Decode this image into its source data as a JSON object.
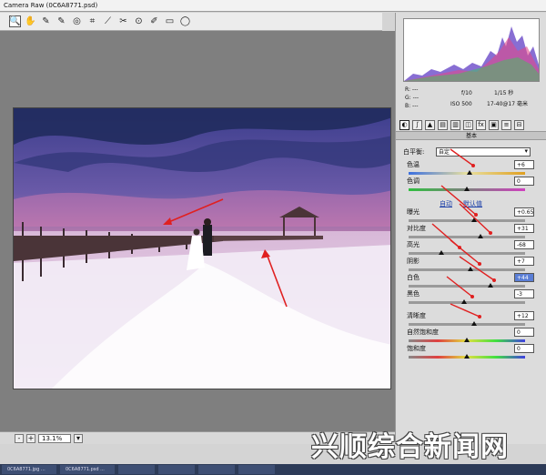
{
  "window": {
    "title": "Camera Raw (0C6A8771.psd)"
  },
  "toolbar": {
    "tools": [
      "zoom-icon",
      "hand-icon",
      "eyedropper-icon",
      "color-sampler-icon",
      "target-adjust-icon",
      "crop-icon",
      "straighten-icon",
      "spot-removal-icon",
      "red-eye-icon",
      "brush-icon",
      "gradient-icon"
    ]
  },
  "zoom": {
    "value": "13.1%",
    "minus": "-",
    "plus": "+"
  },
  "readouts": {
    "r": "R: ---",
    "g": "G: ---",
    "b": "B: ---",
    "aperture": "f/10",
    "shutter": "1/15 秒",
    "iso": "ISO 500",
    "lens": "17-40@17 毫米"
  },
  "panel": {
    "section_title": "基本",
    "white_balance_label": "白平衡:",
    "white_balance_value": "自定",
    "auto_label": "自动",
    "default_label": "默认值",
    "sliders": [
      {
        "label": "色温",
        "value": "+6",
        "pos": 0.52
      },
      {
        "label": "色调",
        "value": "0",
        "pos": 0.5
      },
      {
        "label": "曝光",
        "value": "+0.65",
        "pos": 0.56
      },
      {
        "label": "对比度",
        "value": "+31",
        "pos": 0.62
      },
      {
        "label": "高光",
        "value": "-68",
        "pos": 0.28
      },
      {
        "label": "阴影",
        "value": "+7",
        "pos": 0.53
      },
      {
        "label": "白色",
        "value": "+44",
        "pos": 0.7
      },
      {
        "label": "黑色",
        "value": "-3",
        "pos": 0.48
      },
      {
        "label": "清晰度",
        "value": "+12",
        "pos": 0.56
      },
      {
        "label": "自然饱和度",
        "value": "0",
        "pos": 0.5
      },
      {
        "label": "饱和度",
        "value": "0",
        "pos": 0.5
      }
    ]
  },
  "taskbar": {
    "items": [
      "0C6A8771.jpg ...",
      "0C6A8771.psd ...",
      "",
      "",
      "",
      ""
    ]
  },
  "watermark": "兴顺综合新闻网",
  "colors": {
    "accent_arrow": "#e02020",
    "selected_value": "#5a7ed6",
    "taskbar": "#2d3b58"
  }
}
